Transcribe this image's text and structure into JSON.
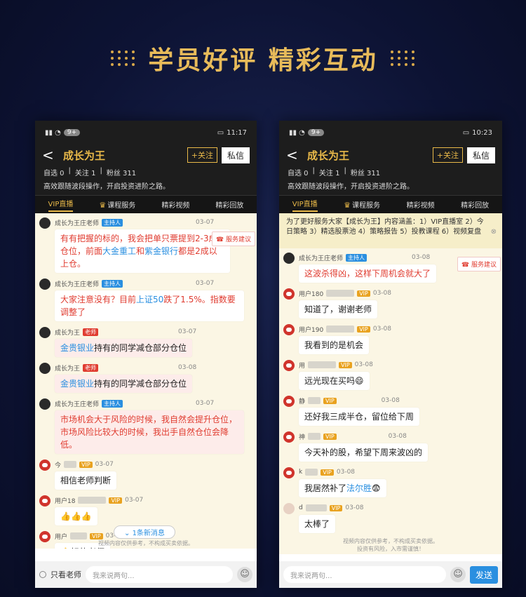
{
  "heading": {
    "title": "学员好评 精彩互动"
  },
  "phones": [
    {
      "status": {
        "badge": "9+",
        "time": "11:17"
      },
      "header": {
        "back": "<",
        "name": "成长为王",
        "follow": "+关注",
        "message": "私信",
        "stats": [
          "自选 0",
          "关注 1",
          "粉丝 311"
        ],
        "desc": "高效跟随波段操作，开启投资进阶之路。"
      },
      "tabs": [
        "VIP直播",
        "课程服务",
        "精彩视频",
        "精彩回放"
      ],
      "suggest": "服务建议",
      "new_messages": "1条新消息",
      "footnote": "视频内容仅供参考，不构成买卖依据。",
      "input": {
        "only_teacher": "只看老师",
        "placeholder": "我来说两句..."
      }
    },
    {
      "status": {
        "badge": "9+",
        "time": "10:23"
      },
      "header": {
        "back": "<",
        "name": "成长为王",
        "follow": "+关注",
        "message": "私信",
        "stats": [
          "自选 0",
          "关注 1",
          "粉丝 311"
        ],
        "desc": "高效跟随波段操作，开启投资进阶之路。"
      },
      "tabs": [
        "VIP直播",
        "课程服务",
        "精彩视频",
        "精彩回放"
      ],
      "notice": "为了更好服务大家【成长为王】内容涵盖：1）VIP直播室 2）今日策略 3）精选股票池 4）策略报告 5）投教课程 6）视频复盘",
      "suggest": "服务建议",
      "footnote": [
        "视频内容仅供参考，不构成买卖依据。",
        "投资有风险，入市需谨慎！"
      ],
      "input": {
        "placeholder": "我来说两句...",
        "send": "发送"
      }
    }
  ],
  "chat1": {
    "m1": {
      "user": "成长为王庄老师",
      "tag": "主持人",
      "time": "03-07",
      "pre": "有有把握的标的，我会把单只票提到2-3成仓位，前面",
      "l1": "大金重工",
      "mid": "和",
      "l2": "紫金银行",
      "post": "都是2成以上仓。"
    },
    "m2": {
      "user": "成长为王庄老师",
      "tag": "主持人",
      "time": "03-07",
      "pre": "大家注意没有？目前",
      "l1": "上证50",
      "post": "跌了1.5%。指数要调整了"
    },
    "m3": {
      "user": "成长为王",
      "tag": "老师",
      "time": "03-07",
      "link": "金贵银业",
      "post": "持有的同学减仓部分仓位"
    },
    "m4": {
      "user": "成长为王",
      "tag": "老师",
      "time": "03-08",
      "link": "金贵银业",
      "post": "持有的同学减仓部分仓位"
    },
    "m5": {
      "user": "成长为王庄老师",
      "tag": "主持人",
      "time": "03-07",
      "text": "市场机会大于风险的时候，我自然会提升仓位，市场风险比较大的时候，我出手自然仓位会降低。"
    },
    "m6": {
      "user": "今",
      "tag": "VIP",
      "time": "03-07",
      "text": "相信老师判断"
    },
    "m7": {
      "user": "用户18",
      "tag": "VIP",
      "time": "03-07",
      "text": "👍👍👍"
    },
    "m8": {
      "user": "用户",
      "tag": "VIP",
      "time": "03-07",
      "text": "👌好的老师"
    }
  },
  "chat2": {
    "m1": {
      "user": "成长为王庄老师",
      "tag": "主持人",
      "time": "03-08",
      "text": "这波杀得凶，这样下周机会就大了"
    },
    "m2": {
      "user": "用户180",
      "tag": "VIP",
      "time": "03-08",
      "text": "知道了，谢谢老师"
    },
    "m3": {
      "user": "用户190",
      "tag": "VIP",
      "time": "03-08",
      "text": "我看到的是机会"
    },
    "m4": {
      "user": "用",
      "tag": "VIP",
      "time": "03-08",
      "text": "远光现在买吗😄"
    },
    "m5": {
      "user": "静",
      "tag": "VIP",
      "time": "03-08",
      "text": "还好我三成半仓，留位给下周"
    },
    "m6": {
      "user": "神",
      "tag": "VIP",
      "time": "03-08",
      "text": "今天补的股，希望下周来波凶的"
    },
    "m7": {
      "user": "k",
      "tag": "VIP",
      "time": "03-08",
      "pre": "我居然补了",
      "link": "法尔胜",
      "post": "😨"
    },
    "m8": {
      "user": "d",
      "tag": "VIP",
      "time": "03-08",
      "text": "太棒了"
    }
  }
}
